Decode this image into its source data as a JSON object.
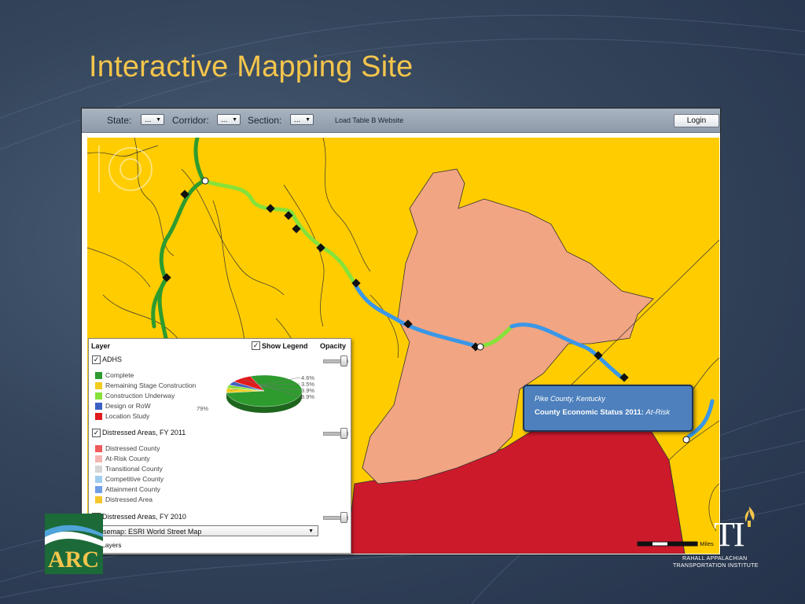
{
  "slide": {
    "title": "Interactive Mapping Site"
  },
  "toolbar": {
    "state_label": "State:",
    "state_value": "...",
    "corridor_label": "Corridor:",
    "corridor_value": "...",
    "section_label": "Section:",
    "section_value": "...",
    "link_label": "Load Table B Website",
    "login_label": "Login"
  },
  "legend": {
    "layer_header": "Layer",
    "show_legend_label": "Show Legend",
    "opacity_header": "Opacity",
    "layers": [
      {
        "label": "ADHS",
        "checked": true,
        "items": [
          {
            "label": "Complete",
            "color": "#2e9b2e"
          },
          {
            "label": "Remaining Stage Construction",
            "color": "#f2cc1f"
          },
          {
            "label": "Construction Underway",
            "color": "#86e23a"
          },
          {
            "label": "Design or RoW",
            "color": "#3b5fc4"
          },
          {
            "label": "Location Study",
            "color": "#e01b1b"
          }
        ]
      },
      {
        "label": "Distressed Areas, FY 2011",
        "checked": true,
        "items": [
          {
            "label": "Distressed County",
            "color": "#ef5b5b"
          },
          {
            "label": "At-Risk County",
            "color": "#f5b5b0"
          },
          {
            "label": "Transitional County",
            "color": "#d6d6d6"
          },
          {
            "label": "Competitive County",
            "color": "#9fcdef"
          },
          {
            "label": "Attainment County",
            "color": "#6f9ee6"
          },
          {
            "label": "Distressed Area",
            "color": "#f5c62c"
          }
        ]
      },
      {
        "label": "Distressed Areas, FY 2010",
        "checked": false,
        "items": []
      }
    ],
    "basemap_label": "Basemap: ESRI World Street Map",
    "layers_toggle_label": "Layers"
  },
  "chart_data": {
    "type": "pie",
    "labels": [
      "Complete",
      "Remaining Stage Construction",
      "Construction Underway",
      "Design or RoW",
      "Location Study"
    ],
    "values": [
      79,
      4.6,
      3.5,
      3.9,
      8.9
    ],
    "value_labels": [
      "79%",
      "4.6%",
      "3.5%",
      "3.9%",
      "8.9%"
    ],
    "colors": [
      "#2e9b2e",
      "#f2cc1f",
      "#86e23a",
      "#3b5fc4",
      "#e01b1b"
    ],
    "title": ""
  },
  "popup": {
    "county": "Pike County, Kentucky",
    "status_label": "County Economic Status 2011:",
    "status_value": "At-Risk"
  },
  "scale": {
    "label": "2 Miles"
  },
  "logos": {
    "arc": "ARC",
    "rati_mark": "TI",
    "rati_line1": "RAHALL APPALACHIAN",
    "rati_line2": "TRANSPORTATION INSTITUTE"
  },
  "colors": {
    "title": "#f4c54c",
    "distressed_area": "#ffcc00",
    "at_risk_county": "#f2a582",
    "distressed_county": "#cc1a2b",
    "route_complete": "#2e9b2e",
    "route_underway": "#86e23a",
    "route_design": "#3a97e8",
    "popup_bg": "#4d80bd"
  }
}
